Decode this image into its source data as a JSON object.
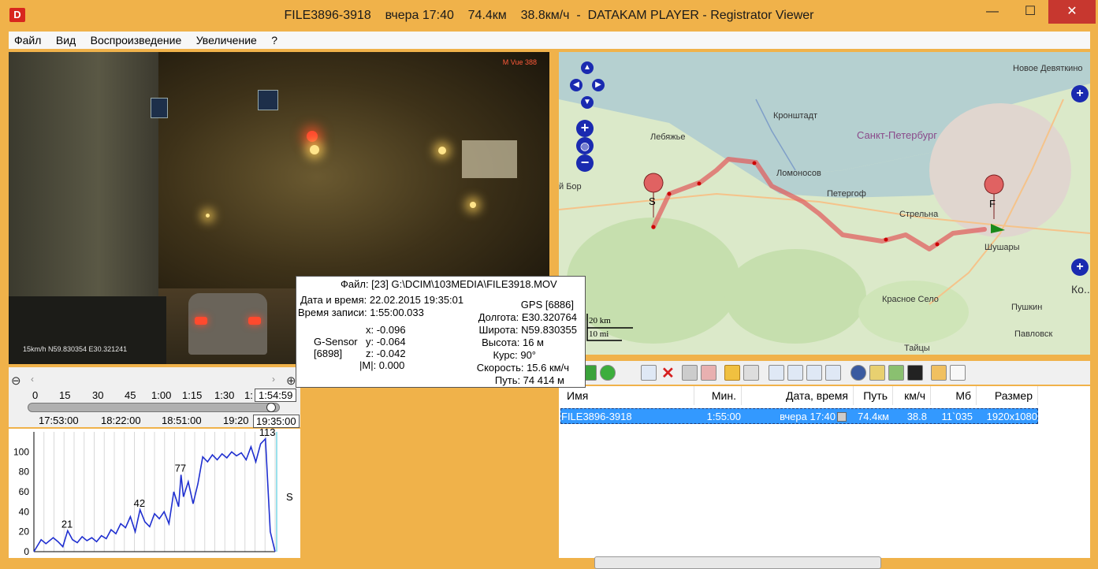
{
  "window": {
    "title": "FILE3896-3918    вчера 17:40    74.4км    38.8км/ч  -  DATAKAM PLAYER - Registrator Viewer",
    "logo_text": "D",
    "minimize": "—",
    "maximize": "☐",
    "close": "✕"
  },
  "menu": {
    "items": [
      "Файл",
      "Вид",
      "Воспроизведение",
      "Увеличение",
      "?"
    ]
  },
  "video": {
    "brand": "M Vue 388",
    "overlay_text": "15km/h N59.830354 E30.321241"
  },
  "info_popup": {
    "file": "Файл: [23] G:\\DCIM\\103MEDIA\\FILE3918.MOV",
    "datetime": "Дата и время: 22.02.2015 19:35:01",
    "record_time": "Время записи: 1:55:00.033",
    "gsensor_label": "G-Sensor",
    "gsensor_count": "[6898]",
    "x": "x: -0.096",
    "y": "y: -0.064",
    "z": "z: -0.042",
    "m": "|M|:  0.000",
    "gps": "GPS [6886]",
    "longitude": "Долгота: E30.320764",
    "latitude": "Широта: N59.830355",
    "altitude": "Высота: 16 м",
    "course": "Курс: 90°",
    "speed": "Скорость: 15.6 км/ч",
    "distance": "Путь: 74 414 м"
  },
  "timeline": {
    "ticks_top": [
      "0",
      "15",
      "30",
      "45",
      "1:00",
      "1:15",
      "1:30",
      "1:"
    ],
    "current_top": "1:54:59",
    "ticks_bottom": [
      "17:53:00",
      "18:22:00",
      "18:51:00",
      "19:20"
    ],
    "current_bottom": "19:35:00",
    "progress": 0.98
  },
  "chart_data": {
    "type": "line",
    "title": "",
    "xlabel": "",
    "ylabel": "",
    "ylim": [
      0,
      120
    ],
    "yticks": [
      "0",
      "20",
      "40",
      "60",
      "80",
      "100"
    ],
    "annotations": [
      {
        "label": "21",
        "x": 0.14,
        "y": 21
      },
      {
        "label": "42",
        "x": 0.44,
        "y": 42
      },
      {
        "label": "77",
        "x": 0.61,
        "y": 77
      },
      {
        "label": "113",
        "x": 0.96,
        "y": 113
      }
    ],
    "side_label": "S",
    "series": [
      {
        "x": [
          0.0,
          0.03,
          0.05,
          0.08,
          0.1,
          0.12,
          0.14,
          0.16,
          0.18,
          0.2,
          0.22,
          0.24,
          0.26,
          0.28,
          0.3,
          0.32,
          0.34,
          0.36,
          0.38,
          0.4,
          0.42,
          0.44,
          0.46,
          0.48,
          0.5,
          0.52,
          0.54,
          0.56,
          0.58,
          0.6,
          0.61,
          0.62,
          0.64,
          0.66,
          0.68,
          0.7,
          0.72,
          0.74,
          0.76,
          0.78,
          0.8,
          0.82,
          0.84,
          0.86,
          0.88,
          0.9,
          0.92,
          0.94,
          0.96,
          0.98,
          1.0
        ],
        "y": [
          0,
          12,
          8,
          14,
          10,
          5,
          21,
          12,
          9,
          15,
          11,
          14,
          10,
          16,
          13,
          22,
          18,
          28,
          24,
          35,
          20,
          42,
          30,
          25,
          38,
          33,
          40,
          28,
          60,
          45,
          77,
          55,
          70,
          48,
          68,
          95,
          90,
          97,
          92,
          98,
          94,
          100,
          96,
          99,
          92,
          105,
          90,
          108,
          113,
          20,
          0
        ]
      }
    ]
  },
  "map": {
    "labels": [
      {
        "name": "Новое Девяткино"
      },
      {
        "name": "Кронштадт"
      },
      {
        "name": "Санкт-Петербург"
      },
      {
        "name": "Лебяжье"
      },
      {
        "name": "Ломоносов"
      },
      {
        "name": "Петергоф"
      },
      {
        "name": "Стрельна"
      },
      {
        "name": "Шушары"
      },
      {
        "name": "Красное Село"
      },
      {
        "name": "Пушкин"
      },
      {
        "name": "Павловск"
      },
      {
        "name": "Тайцы"
      },
      {
        "name": "Ко.."
      },
      {
        "name": "й Бор"
      }
    ],
    "scale_km": "20 km",
    "scale_mi": "10 mi",
    "start_marker": "S",
    "finish_marker": "F"
  },
  "filetable": {
    "headers": [
      "Имя",
      "Мин.",
      "Дата, время",
      "Путь",
      "км/ч",
      "Мб",
      "Размер"
    ],
    "rows": [
      {
        "name": "FILE3896-3918",
        "min": "1:55:00",
        "datetime": "вчера 17:40",
        "path": "74.4км",
        "speed": "38.8",
        "mb": "11`035",
        "size": "1920x1080"
      }
    ]
  }
}
